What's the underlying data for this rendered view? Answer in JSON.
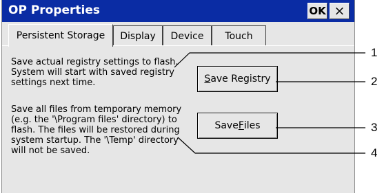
{
  "window": {
    "title": "OP Properties",
    "ok_label": "OK",
    "close_label": "×"
  },
  "tabs": [
    {
      "label": "Persistent Storage",
      "active": true
    },
    {
      "label": "Display",
      "active": false
    },
    {
      "label": "Device",
      "active": false
    },
    {
      "label": "Touch",
      "active": false
    }
  ],
  "registry": {
    "lines": [
      "Save actual registry settings to flash.",
      "System will start with saved registry",
      "settings next time."
    ],
    "button_prefix": "",
    "button_mnemonic": "S",
    "button_suffix": "ave Registry"
  },
  "files": {
    "lines": [
      "Save all files from temporary memory",
      "(e.g. the '\\Program files' directory) to",
      "flash. The files will be restored during",
      "system startup. The '\\Temp' directory",
      "will not be saved."
    ],
    "button_prefix": "Save ",
    "button_mnemonic": "F",
    "button_suffix": "iles"
  },
  "callouts": [
    "1",
    "2",
    "3",
    "4"
  ]
}
